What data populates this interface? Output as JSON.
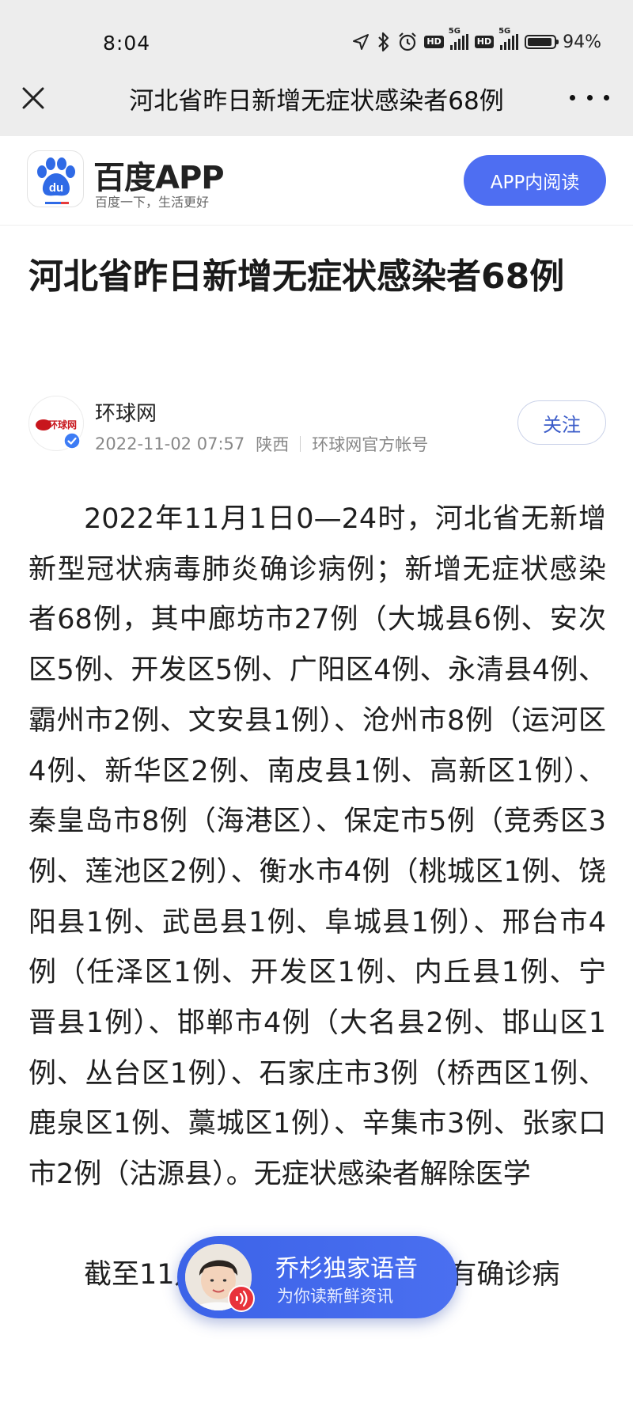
{
  "status_bar": {
    "time": "8:04",
    "hd1": "HD",
    "hd2": "HD",
    "net1": "5G",
    "net2": "5G",
    "battery": "94%"
  },
  "title_bar": {
    "title": "河北省昨日新增无症状感染者68例"
  },
  "baidu": {
    "logo_text": "du",
    "brand": "百度APP",
    "slogan": "百度一下，生活更好",
    "read_in_app": "APP内阅读"
  },
  "article": {
    "title": "河北省昨日新增无症状感染者68例",
    "author": {
      "name": "环球网",
      "avatar_text": "环球网",
      "date": "2022-11-02 07:57",
      "region": "陕西",
      "account_type": "环球网官方帐号"
    },
    "follow_label": "关注",
    "paragraphs": [
      "2022年11月1日0—24时，河北省无新增新型冠状病毒肺炎确诊病例；新增无症状感染者68例，其中廊坊市27例（大城县6例、安次区5例、开发区5例、广阳区4例、永清县4例、霸州市2例、文安县1例）、沧州市8例（运河区4例、新华区2例、南皮县1例、高新区1例）、秦皇岛市8例（海港区）、保定市5例（竞秀区3例、莲池区2例）、衡水市4例（桃城区1例、饶阳县1例、武邑县1例、阜城县1例）、邢台市4例（任泽区1例、开发区1例、内丘县1例、宁晋县1例）、邯郸市4例（大名县2例、邯山区1例、丛台区1例）、石家庄市3例（桥西区1例、鹿泉区1例、藁城区1例）、辛集市3例、张家口市2例（沽源县）。无症状感染者解除医学",
      "截至11月1日24时，河北省现有确诊病"
    ]
  },
  "voice_player": {
    "title": "乔杉独家语音",
    "subtitle": "为你读新鲜资讯"
  },
  "colors": {
    "accent": "#4e6ef2",
    "follow_text": "#3b5cc9",
    "topbar_bg": "#ededed"
  }
}
